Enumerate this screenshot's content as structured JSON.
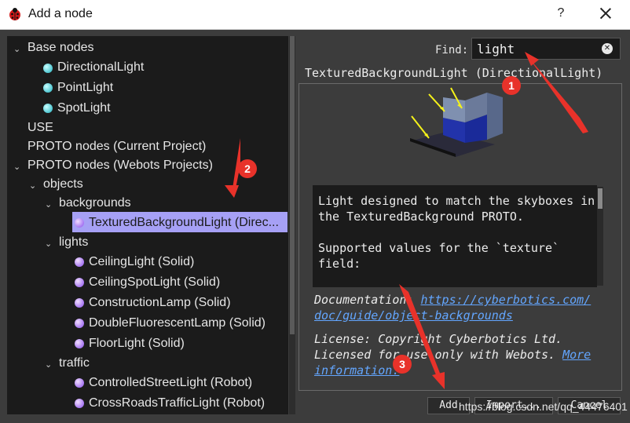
{
  "window": {
    "title": "Add a node",
    "help": "?",
    "close_icon": "close-icon"
  },
  "tree": {
    "items": [
      {
        "label": "Base nodes",
        "expanded": true
      },
      {
        "label": "DirectionalLight",
        "icon": "teal-ball-icon"
      },
      {
        "label": "PointLight",
        "icon": "teal-ball-icon"
      },
      {
        "label": "SpotLight",
        "icon": "teal-ball-icon"
      },
      {
        "label": "USE"
      },
      {
        "label": "PROTO nodes (Current Project)"
      },
      {
        "label": "PROTO nodes (Webots Projects)",
        "expanded": true
      },
      {
        "label": "objects",
        "expanded": true
      },
      {
        "label": "backgrounds",
        "expanded": true
      },
      {
        "label": "TexturedBackgroundLight (Direc...",
        "icon": "violet-ball-icon",
        "selected": true
      },
      {
        "label": "lights",
        "expanded": true
      },
      {
        "label": "CeilingLight (Solid)",
        "icon": "violet-ball-icon"
      },
      {
        "label": "CeilingSpotLight (Solid)",
        "icon": "violet-ball-icon"
      },
      {
        "label": "ConstructionLamp (Solid)",
        "icon": "violet-ball-icon"
      },
      {
        "label": "DoubleFluorescentLamp (Solid)",
        "icon": "violet-ball-icon"
      },
      {
        "label": "FloorLight (Solid)",
        "icon": "violet-ball-icon"
      },
      {
        "label": "traffic",
        "expanded": true
      },
      {
        "label": "ControlledStreetLight (Robot)",
        "icon": "violet-ball-icon"
      },
      {
        "label": "CrossRoadsTrafficLight (Robot)",
        "icon": "violet-ball-icon"
      }
    ]
  },
  "find": {
    "label": "Find:",
    "value": "light"
  },
  "details": {
    "title": "TexturedBackgroundLight (DirectionalLight)",
    "description": "Light designed to match the skyboxes in\nthe TexturedBackground PROTO.\n\nSupported values for the `texture`\nfield:",
    "doc_label": "Documentation:",
    "doc_link_1": "https://cyberbotics.com/",
    "doc_link_2": "doc/guide/object-backgrounds",
    "license_1": "License: Copyright Cyberbotics Ltd.",
    "license_2": "Licensed for use only with Webots.",
    "more_link_1": "More",
    "more_link_2": "information."
  },
  "buttons": {
    "add": "Add",
    "import": "Import...",
    "cancel": "Cancel"
  },
  "watermark": "https://blog.csdn.net/qq_44476401",
  "annotations": {
    "badge1": "1",
    "badge2": "2",
    "badge3": "3"
  },
  "colors": {
    "selection": "#a6a0f5",
    "link": "#63a6ff",
    "annotation": "#e8322a"
  }
}
